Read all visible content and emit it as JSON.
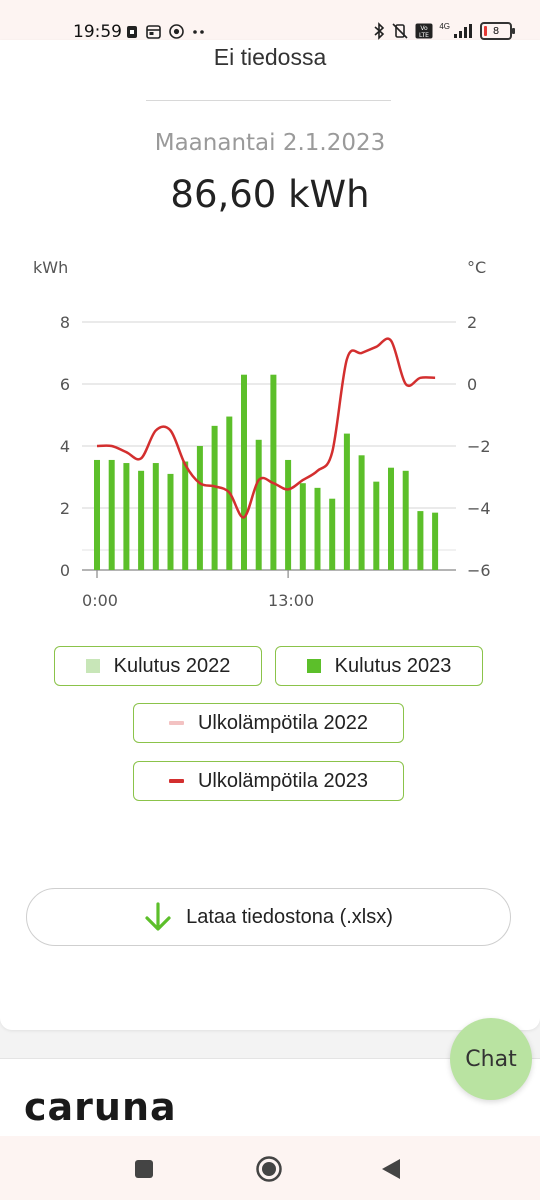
{
  "status_bar": {
    "time": "19:59",
    "left_icons": [
      "sim-card-icon",
      "calendar-icon",
      "chrome-icon",
      "more-dots-icon"
    ],
    "right_icons": [
      "bluetooth-icon",
      "vibrate-off-icon",
      "volte-icon",
      "signal-4g-icon",
      "battery-icon"
    ],
    "battery_level": "8",
    "network_label": "4G"
  },
  "header": {
    "previous_value_text": "Ei tiedossa",
    "date": "Maanantai 2.1.2023",
    "total": "86,60 kWh"
  },
  "chart_data": {
    "type": "bar",
    "left_axis_unit": "kWh",
    "right_axis_unit": "°C",
    "left_ticks": [
      "0",
      "2",
      "4",
      "6",
      "8"
    ],
    "right_ticks": [
      "−6",
      "−4",
      "−2",
      "0",
      "2"
    ],
    "x_tick_labels": [
      "0:00",
      "13:00"
    ],
    "ylim": [
      0,
      8
    ],
    "y2lim": [
      -6,
      2
    ],
    "hours": [
      0,
      1,
      2,
      3,
      4,
      5,
      6,
      7,
      8,
      9,
      10,
      11,
      12,
      13,
      14,
      15,
      16,
      17,
      18,
      19,
      20,
      21,
      22,
      23
    ],
    "series": [
      {
        "name": "Kulutus 2023",
        "kind": "bar",
        "color": "#5cbf2a",
        "values": [
          3.55,
          3.55,
          3.45,
          3.2,
          3.45,
          3.1,
          3.5,
          4.0,
          4.65,
          4.95,
          6.3,
          4.2,
          6.3,
          3.55,
          2.8,
          2.65,
          2.3,
          4.4,
          3.7,
          2.85,
          3.3,
          3.2,
          1.9,
          1.85
        ]
      },
      {
        "name": "Ulkolämpötila 2023",
        "kind": "line",
        "color": "#d32f2f",
        "values": [
          -2.0,
          -2.0,
          -2.2,
          -2.4,
          -1.5,
          -1.5,
          -2.6,
          -3.2,
          -3.3,
          -3.5,
          -4.3,
          -3.1,
          -3.2,
          -3.4,
          -3.1,
          -2.8,
          -2.2,
          0.8,
          1.0,
          1.2,
          1.4,
          0.0,
          0.2,
          0.2
        ]
      }
    ],
    "legend": [
      {
        "label": "Kulutus 2022",
        "shape": "square",
        "color": "#c8e6b8"
      },
      {
        "label": "Kulutus 2023",
        "shape": "square",
        "color": "#5cbf2a"
      },
      {
        "label": "Ulkolämpötila 2022",
        "shape": "line",
        "color": "#f3c2c2"
      },
      {
        "label": "Ulkolämpötila 2023",
        "shape": "line",
        "color": "#d32f2f"
      }
    ]
  },
  "download": {
    "label": "Lataa tiedostona (.xlsx)",
    "icon": "download-arrow-icon",
    "icon_color": "#5cbf2a"
  },
  "footer": {
    "logo_text": "caruna"
  },
  "chat": {
    "label": "Chat"
  },
  "nav_bar": {
    "buttons": [
      "recents-square-icon",
      "home-circle-icon",
      "back-triangle-icon"
    ]
  },
  "colors": {
    "accent_green": "#5cbf2a",
    "chip_border": "#8bc34a",
    "chat_bg": "#b9e3a1",
    "temp_line": "#d32f2f"
  }
}
